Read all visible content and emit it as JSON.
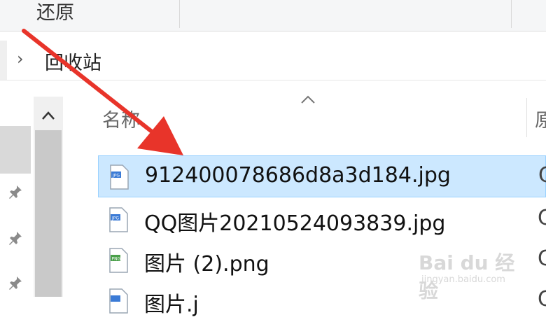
{
  "toolbar": {
    "restore_label": "还原"
  },
  "address": {
    "folder": "回收站"
  },
  "list": {
    "header": {
      "name_col": "名称",
      "next_col": "原"
    },
    "files": [
      {
        "name": "912400078686d8a3d184.jpg",
        "type": "jpg",
        "right_text": "C"
      },
      {
        "name": "QQ图片20210524093839.jpg",
        "type": "jpg",
        "right_text": "C"
      },
      {
        "name": "图片 (2).png",
        "type": "png",
        "right_text": "C"
      },
      {
        "name": "图片.j",
        "type": "jpg",
        "right_text": "C"
      }
    ]
  },
  "watermark": {
    "text": "Bai du 经验",
    "sub": "jingyan.baidu.com"
  },
  "colors": {
    "selection": "#cce8ff",
    "arrow": "#e8342a"
  }
}
